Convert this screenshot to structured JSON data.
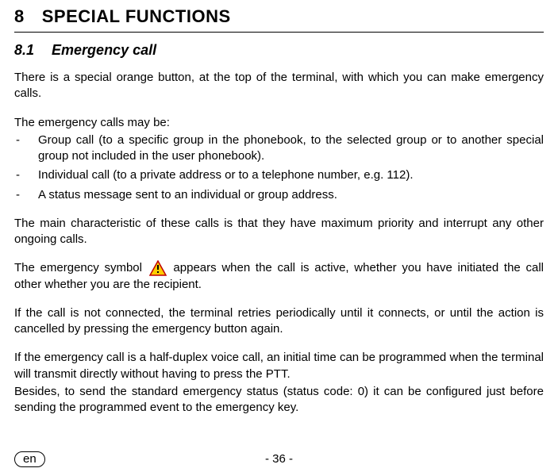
{
  "section": {
    "number": "8",
    "title": "SPECIAL FUNCTIONS"
  },
  "subsection": {
    "number": "8.1",
    "title": "Emergency call"
  },
  "paragraphs": {
    "intro": "There is a special orange button, at the top of the terminal, with which you can make emergency calls.",
    "list_lead": "The emergency calls may be:",
    "priority": "The main characteristic of these calls is that they have maximum priority and interrupt any other ongoing calls.",
    "symbol_before": "The emergency symbol",
    "symbol_after": "appears when the call is active, whether you have initiated the call other whether you are the recipient.",
    "retry": "If the call is not connected, the terminal retries periodically until it connects, or until the action is cancelled by pressing the emergency button again.",
    "halfduplex": "If the emergency call is a half-duplex voice call, an initial time can be programmed when the terminal will transmit directly without having to press the PTT.",
    "status": "Besides, to send the standard emergency status (status code: 0) it can be configured just before sending the programmed event to the emergency key."
  },
  "list_items": [
    "Group call (to a specific group in the phonebook, to the selected group or to another special group not included in the user phonebook).",
    "Individual call (to a private address or to a telephone number, e.g. 112).",
    "A status message sent to an individual or group address."
  ],
  "footer": {
    "page": "- 36 -",
    "lang": "en"
  }
}
